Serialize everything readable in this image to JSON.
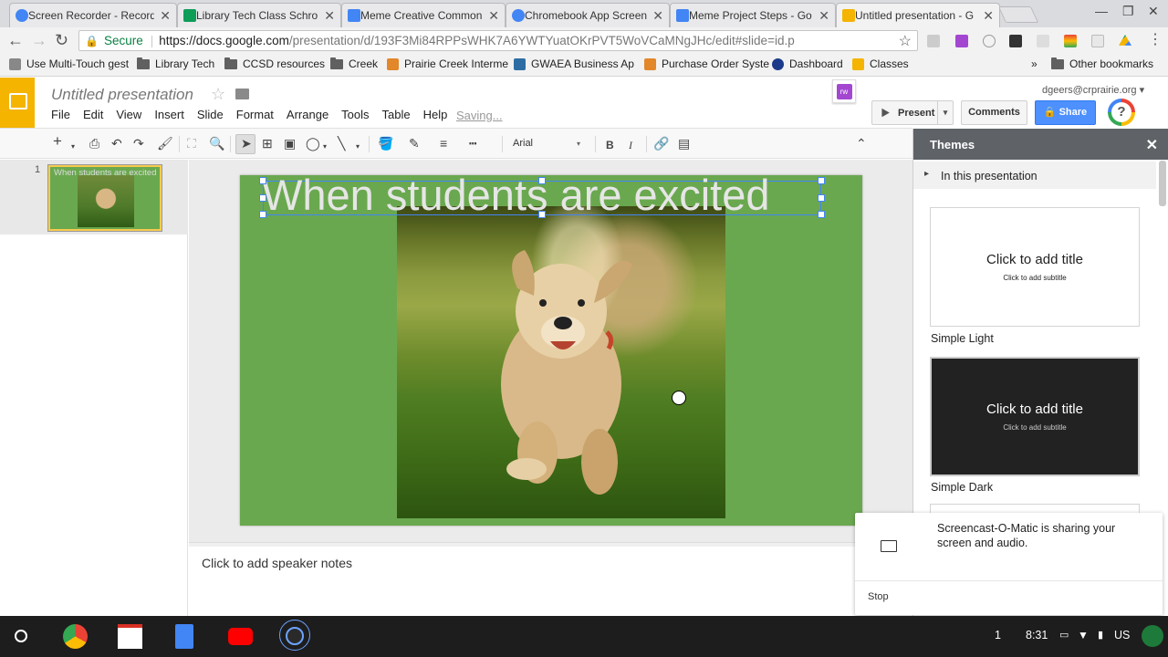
{
  "browser": {
    "tabs": [
      {
        "title": "Screen Recorder - Record",
        "fav_color": "#4285f4"
      },
      {
        "title": "Library Tech Class Schro",
        "fav_color": "#0f9d58"
      },
      {
        "title": "Meme Creative Common",
        "fav_color": "#4285f4"
      },
      {
        "title": "Chromebook App Screen",
        "fav_color": "#4285f4"
      },
      {
        "title": "Meme Project Steps - Go",
        "fav_color": "#4285f4"
      },
      {
        "title": "Untitled presentation - G",
        "fav_color": "#f4b400"
      }
    ],
    "secure_label": "Secure",
    "url_host": "https://docs.google.com",
    "url_path": "/presentation/d/193F3Mi84RPPsWHK7A6YWTYuatOKrPVT5WoVCaMNgJHc/edit#slide=id.p",
    "bookmarks": [
      {
        "label": "Use Multi-Touch gest",
        "icon": "page-icon"
      },
      {
        "label": "Library Tech",
        "icon": "folder-icon"
      },
      {
        "label": "CCSD resources",
        "icon": "folder-icon"
      },
      {
        "label": "Creek",
        "icon": "folder-icon"
      },
      {
        "label": "Prairie Creek Interme",
        "icon": "site-icon"
      },
      {
        "label": "GWAEA Business Ap",
        "icon": "site-icon"
      },
      {
        "label": "Purchase Order Syste",
        "icon": "site-icon"
      },
      {
        "label": "Dashboard",
        "icon": "site-icon"
      },
      {
        "label": "Classes",
        "icon": "site-icon"
      }
    ],
    "overflow_chevron": "»",
    "other_bookmarks": "Other bookmarks"
  },
  "app": {
    "doc_title": "Untitled presentation",
    "menu": [
      "File",
      "Edit",
      "View",
      "Insert",
      "Slide",
      "Format",
      "Arrange",
      "Tools",
      "Table",
      "Help"
    ],
    "saving": "Saving...",
    "addon_label": "rw",
    "user_email": "dgeers@crprairie.org",
    "present_label": "Present",
    "comments_label": "Comments",
    "share_label": "Share",
    "avatar_glyph": "?",
    "brand_color": "#f4b400",
    "share_color": "#4d90fe"
  },
  "toolbar": {
    "font_name": "Arial",
    "bold": "B",
    "italic": "I"
  },
  "filmstrip": {
    "slide_number": "1",
    "thumb_title": "When students are excited"
  },
  "slide": {
    "title": "When students are excited",
    "background_color": "#6aa84f"
  },
  "notes": {
    "placeholder": "Click to add speaker notes"
  },
  "themes": {
    "header": "Themes",
    "section": "In this presentation",
    "cards": [
      {
        "title": "Click to add title",
        "subtitle": "Click to add subtitle",
        "name": "Simple Light",
        "bg": "#ffffff",
        "fg": "#222222"
      },
      {
        "title": "Click to add title",
        "subtitle": "Click to add subtitle",
        "name": "Simple Dark",
        "bg": "#222222",
        "fg": "#ffffff"
      }
    ]
  },
  "notification": {
    "message": "Screencast-O-Matic is sharing your screen and audio.",
    "stop_label": "Stop"
  },
  "shelf": {
    "apps": [
      "chrome-icon",
      "gmail-icon",
      "docs-icon",
      "youtube-icon",
      "screencast-icon"
    ],
    "notification_count": "1",
    "time": "8:31",
    "locale": "US"
  }
}
